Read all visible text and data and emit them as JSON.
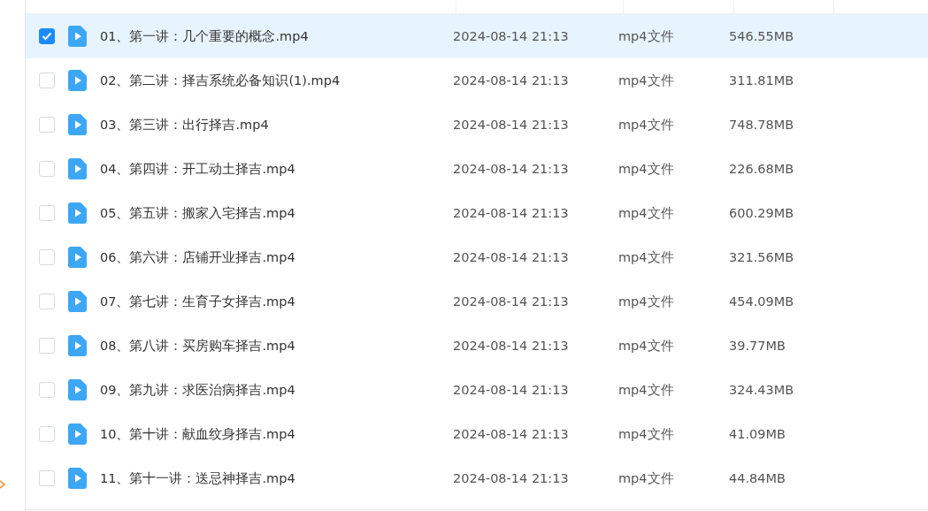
{
  "files": [
    {
      "name": "01、第一讲：几个重要的概念.mp4",
      "modified": "2024-08-14 21:13",
      "type": "mp4文件",
      "size": "546.55MB",
      "selected": true
    },
    {
      "name": "02、第二讲：择吉系统必备知识(1).mp4",
      "modified": "2024-08-14 21:13",
      "type": "mp4文件",
      "size": "311.81MB",
      "selected": false
    },
    {
      "name": "03、第三讲：出行择吉.mp4",
      "modified": "2024-08-14 21:13",
      "type": "mp4文件",
      "size": "748.78MB",
      "selected": false
    },
    {
      "name": "04、第四讲：开工动土择吉.mp4",
      "modified": "2024-08-14 21:13",
      "type": "mp4文件",
      "size": "226.68MB",
      "selected": false
    },
    {
      "name": "05、第五讲：搬家入宅择吉.mp4",
      "modified": "2024-08-14 21:13",
      "type": "mp4文件",
      "size": "600.29MB",
      "selected": false
    },
    {
      "name": "06、第六讲：店铺开业择吉.mp4",
      "modified": "2024-08-14 21:13",
      "type": "mp4文件",
      "size": "321.56MB",
      "selected": false
    },
    {
      "name": "07、第七讲：生育子女择吉.mp4",
      "modified": "2024-08-14 21:13",
      "type": "mp4文件",
      "size": "454.09MB",
      "selected": false
    },
    {
      "name": "08、第八讲：买房购车择吉.mp4",
      "modified": "2024-08-14 21:13",
      "type": "mp4文件",
      "size": "39.77MB",
      "selected": false
    },
    {
      "name": "09、第九讲：求医治病择吉.mp4",
      "modified": "2024-08-14 21:13",
      "type": "mp4文件",
      "size": "324.43MB",
      "selected": false
    },
    {
      "name": "10、第十讲：献血纹身择吉.mp4",
      "modified": "2024-08-14 21:13",
      "type": "mp4文件",
      "size": "41.09MB",
      "selected": false
    },
    {
      "name": "11、第十一讲：送忌神择吉.mp4",
      "modified": "2024-08-14 21:13",
      "type": "mp4文件",
      "size": "44.84MB",
      "selected": false
    }
  ]
}
